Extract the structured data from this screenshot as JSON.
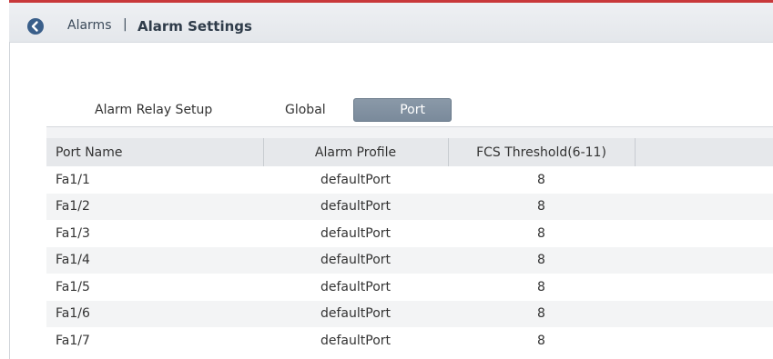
{
  "header": {
    "breadcrumb": "Alarms",
    "separator": "|",
    "title": "Alarm Settings",
    "back_icon": "chevron-left-circle-icon"
  },
  "relay": {
    "label": "Alarm Relay Setup",
    "options": [
      "Global",
      "Port"
    ],
    "selected": "Port"
  },
  "table": {
    "columns": [
      "Port Name",
      "Alarm Profile",
      "FCS Threshold(6-11)",
      ""
    ],
    "rows": [
      {
        "port": "Fa1/1",
        "profile": "defaultPort",
        "fcs": "8"
      },
      {
        "port": "Fa1/2",
        "profile": "defaultPort",
        "fcs": "8"
      },
      {
        "port": "Fa1/3",
        "profile": "defaultPort",
        "fcs": "8"
      },
      {
        "port": "Fa1/4",
        "profile": "defaultPort",
        "fcs": "8"
      },
      {
        "port": "Fa1/5",
        "profile": "defaultPort",
        "fcs": "8"
      },
      {
        "port": "Fa1/6",
        "profile": "defaultPort",
        "fcs": "8"
      },
      {
        "port": "Fa1/7",
        "profile": "defaultPort",
        "fcs": "8"
      }
    ]
  },
  "colors": {
    "accent_red": "#c8383a",
    "back_button": "#3a5f8a",
    "selected_segment": "#7f8e9e"
  }
}
